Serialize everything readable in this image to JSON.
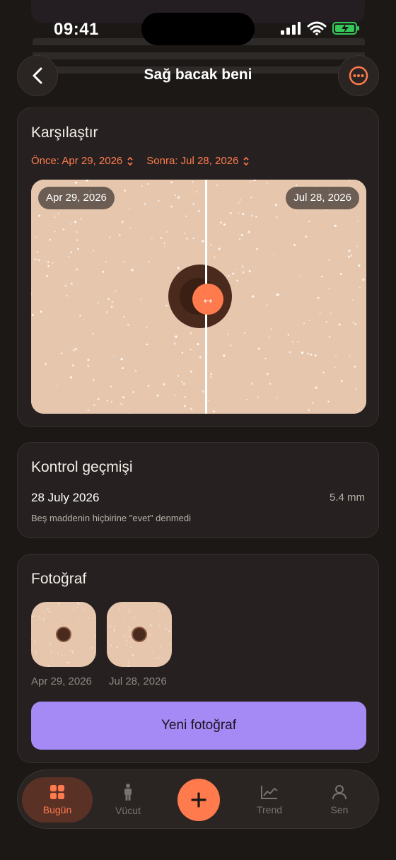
{
  "status_bar": {
    "time": "09:41"
  },
  "nav": {
    "title": "Sağ bacak beni",
    "back_icon": "chevron-left-icon",
    "more_icon": "ellipsis-circle-icon"
  },
  "compare": {
    "title": "Karşılaştır",
    "before_label": "Önce: Apr 29, 2026",
    "after_label": "Sonra: Jul 28, 2026",
    "left_date": "Apr 29, 2026",
    "right_date": "Jul 28, 2026",
    "handle_glyph": "↔"
  },
  "history": {
    "title": "Kontrol geçmişi",
    "entries": [
      {
        "date": "28 July 2026",
        "size": "5.4 mm",
        "note": "Beş maddenin hiçbirine \"evet\" denmedi"
      }
    ]
  },
  "photos": {
    "title": "Fotoğraf",
    "items": [
      {
        "label": "Apr 29, 2026"
      },
      {
        "label": "Jul 28, 2026"
      }
    ],
    "button_label": "Yeni fotoğraf"
  },
  "tabbar": {
    "tabs": [
      {
        "label": "Bugün",
        "icon": "grid-icon",
        "active": true
      },
      {
        "label": "Vücut",
        "icon": "body-icon",
        "active": false
      },
      {
        "label": "Trend",
        "icon": "chart-icon",
        "active": false
      },
      {
        "label": "Sen",
        "icon": "person-icon",
        "active": false
      }
    ],
    "add_icon": "plus-icon"
  },
  "colors": {
    "accent": "#ff7a4d",
    "primary_button": "#a58af5",
    "background": "#1c1816",
    "skin": "#e6c7ae"
  }
}
